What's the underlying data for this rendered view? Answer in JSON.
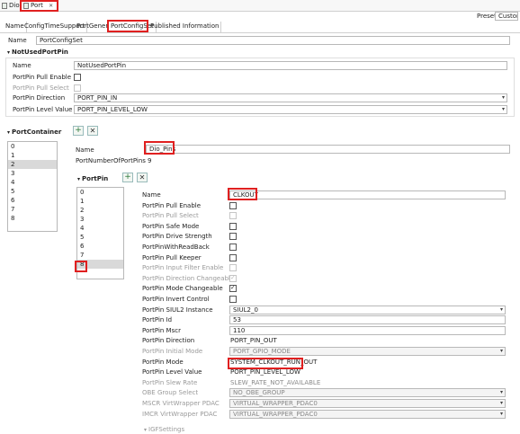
{
  "editor_tabs": [
    {
      "label": "Dio"
    },
    {
      "label": "Port"
    }
  ],
  "preset": {
    "label": "Preset",
    "value": "Custom..."
  },
  "tabs": [
    "Name",
    "ConfigTimeSupport",
    "PortGeneral",
    "PortConfigSet",
    "Published Information"
  ],
  "name_label": "Name",
  "name_value": "PortConfigSet",
  "not_used": {
    "title": "NotUsedPortPin",
    "name_label": "Name",
    "name_value": "NotUsedPortPin",
    "pull_enable_label": "PortPin Pull Enable",
    "pull_select_label": "PortPin Pull Select",
    "direction_label": "PortPin Direction",
    "direction_value": "PORT_PIN_IN",
    "level_label": "PortPin Level Value",
    "level_value": "PORT_PIN_LEVEL_LOW"
  },
  "container": {
    "title": "PortContainer",
    "items": [
      "0",
      "1",
      "2",
      "3",
      "4",
      "5",
      "6",
      "7",
      "8"
    ],
    "selected_index": 2,
    "name_label": "Name",
    "name_value": "Dio_Pins",
    "num_pins_label": "PortNumberOfPortPins",
    "num_pins_value": "9"
  },
  "portpin": {
    "title": "PortPin",
    "items": [
      "0",
      "1",
      "2",
      "3",
      "4",
      "5",
      "6",
      "7",
      "8"
    ],
    "selected_index": 8,
    "rows": [
      {
        "label": "Name",
        "kind": "text",
        "value": "CLKOUT",
        "enabled": true
      },
      {
        "label": "PortPin Pull Enable",
        "kind": "check",
        "checked": false,
        "enabled": true
      },
      {
        "label": "PortPin Pull Select",
        "kind": "check",
        "checked": false,
        "enabled": false
      },
      {
        "label": "PortPin Safe Mode",
        "kind": "check",
        "checked": false,
        "enabled": true
      },
      {
        "label": "PortPin Drive Strength",
        "kind": "check",
        "checked": false,
        "enabled": true
      },
      {
        "label": "PortPinWithReadBack",
        "kind": "check",
        "checked": false,
        "enabled": true
      },
      {
        "label": "PortPin Pull Keeper",
        "kind": "check",
        "checked": false,
        "enabled": true
      },
      {
        "label": "PortPin Input Filter Enable",
        "kind": "check",
        "checked": false,
        "enabled": false
      },
      {
        "label": "PortPin Direction Changeable",
        "kind": "check",
        "checked": true,
        "enabled": false
      },
      {
        "label": "PortPin Mode Changeable",
        "kind": "check",
        "checked": true,
        "enabled": true
      },
      {
        "label": "PortPin Invert Control",
        "kind": "check",
        "checked": false,
        "enabled": true
      },
      {
        "label": "PortPin SIUL2 Instance",
        "kind": "select",
        "value": "SIUL2_0",
        "enabled": true
      },
      {
        "label": "PortPin Id",
        "kind": "text",
        "value": "53",
        "enabled": true
      },
      {
        "label": "PortPin Mscr",
        "kind": "text",
        "value": "110",
        "enabled": true
      },
      {
        "label": "PortPin Direction",
        "kind": "value",
        "value": "PORT_PIN_OUT",
        "enabled": true
      },
      {
        "label": "PortPin Initial Mode",
        "kind": "select",
        "value": "PORT_GPIO_MODE",
        "enabled": false
      },
      {
        "label": "PortPin Mode",
        "kind": "value",
        "value": "SYSTEM_CLKOUT_RUN_OUT",
        "enabled": true
      },
      {
        "label": "PortPin Level Value",
        "kind": "value",
        "value": "PORT_PIN_LEVEL_LOW",
        "enabled": true
      },
      {
        "label": "PortPin Slew Rate",
        "kind": "value",
        "value": "SLEW_RATE_NOT_AVAILABLE",
        "enabled": false
      },
      {
        "label": "OBE Group Select",
        "kind": "select",
        "value": "NO_OBE_GROUP",
        "enabled": false
      },
      {
        "label": "MSCR VirtWrapper PDAC",
        "kind": "select",
        "value": "VIRTUAL_WRAPPER_PDAC0",
        "enabled": false
      },
      {
        "label": "IMCR VirtWrapper PDAC",
        "kind": "select",
        "value": "VIRTUAL_WRAPPER_PDAC0",
        "enabled": false
      }
    ],
    "igf_label": "IGFSettings"
  },
  "colors": {
    "highlight": "#e02020",
    "accent": "#2c7a3a"
  }
}
